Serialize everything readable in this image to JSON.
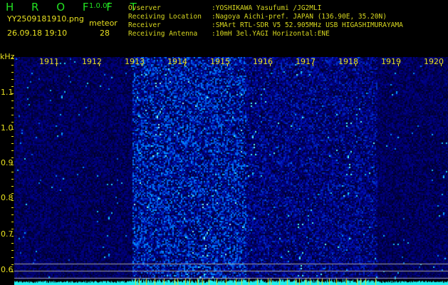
{
  "app": {
    "title": "H R O F F T",
    "version": "1.0.0f"
  },
  "file": {
    "name": "YY2509181910.png",
    "datetime": "26.09.18 19:10"
  },
  "meteor": {
    "label": "meteor",
    "count": "28"
  },
  "info": [
    {
      "key": "Ovserver",
      "value": ":YOSHIKAWA Yasufumi /JG2MLI"
    },
    {
      "key": "Receiving Location",
      "value": ":Nagoya Aichi-pref. JAPAN (136.90E, 35.20N)"
    },
    {
      "key": "Receiver",
      "value": ":SMArt RTL-SDR V5 52.905MHz USB HIGASHIMURAYAMA"
    },
    {
      "key": "Receiving Antenna",
      "value": ":10mH 3el.YAGI Horizontal:ENE"
    }
  ],
  "axis": {
    "y_unit": "kHz",
    "y_ticks": [
      "1.1",
      "1.0",
      "0.9",
      "0.8",
      "0.7",
      "0.6"
    ],
    "x_ticks": [
      "1911",
      "1912",
      "1913",
      "1914",
      "1915",
      "1916",
      "1917",
      "1918",
      "1919",
      "1920"
    ]
  },
  "colors": {
    "label": "#e8e020",
    "title": "#22e022",
    "background": "#000000",
    "baseline": "#20f0f0"
  }
}
